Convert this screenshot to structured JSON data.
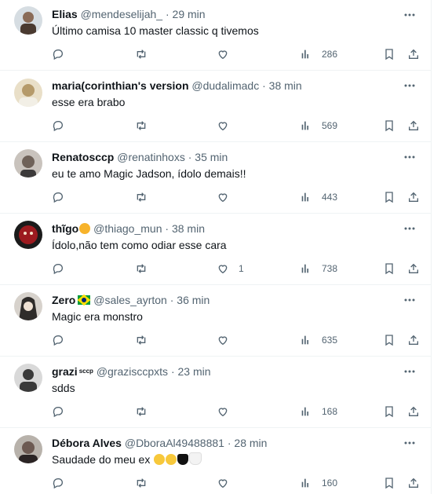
{
  "tweets": [
    {
      "name": "Elias",
      "badge": "",
      "handle": "@mendeselijah_",
      "sep": "·",
      "time": "29 min",
      "text": "Último camisa 10 master classic q tivemos",
      "likes": "",
      "views": "286",
      "avatar_color": "#8a6b57"
    },
    {
      "name": "maria(corinthian's version",
      "badge": "",
      "handle": "@dudalimadc",
      "sep": "·",
      "time": "38 min",
      "text": "esse era brabo",
      "likes": "",
      "views": "569",
      "avatar_color": "#b59a6a"
    },
    {
      "name": "Renatosccp",
      "badge": "",
      "handle": "@renatinhoxs",
      "sep": "·",
      "time": "35 min",
      "text": "eu te amo Magic Jadson, ídolo demais!!",
      "likes": "",
      "views": "443",
      "avatar_color": "#6f6259"
    },
    {
      "name": "thĩgo",
      "badge": "",
      "handle": "@thiago_mun",
      "sep": "·",
      "time": "38 min",
      "text": "Ídolo,não tem como odiar esse cara",
      "likes": "1",
      "views": "738",
      "avatar_color": "#9c1a1f"
    },
    {
      "name": "Zero",
      "badge": "",
      "handle": "@sales_ayrton",
      "sep": "·",
      "time": "36 min",
      "text": "Magic era monstro",
      "likes": "",
      "views": "635",
      "avatar_color": "#2f2c2a"
    },
    {
      "name": "grazi",
      "badge": "sccp",
      "handle": "@grazisccpxts",
      "sep": "·",
      "time": "23 min",
      "text": "sdds",
      "likes": "",
      "views": "168",
      "avatar_color": "#3a3a3a"
    },
    {
      "name": "Débora Alves",
      "badge": "",
      "handle": "@DboraAl49488881",
      "sep": "·",
      "time": "28 min",
      "text": "Saudade do meu ex",
      "likes": "",
      "views": "160",
      "avatar_color": "#6d5a52"
    }
  ],
  "colors": {
    "text": "#0f1419",
    "muted": "#536471",
    "divider": "#eff3f4"
  },
  "icons": [
    "reply-icon",
    "retweet-icon",
    "like-icon",
    "views-icon",
    "bookmark-icon",
    "share-icon",
    "more-icon"
  ]
}
